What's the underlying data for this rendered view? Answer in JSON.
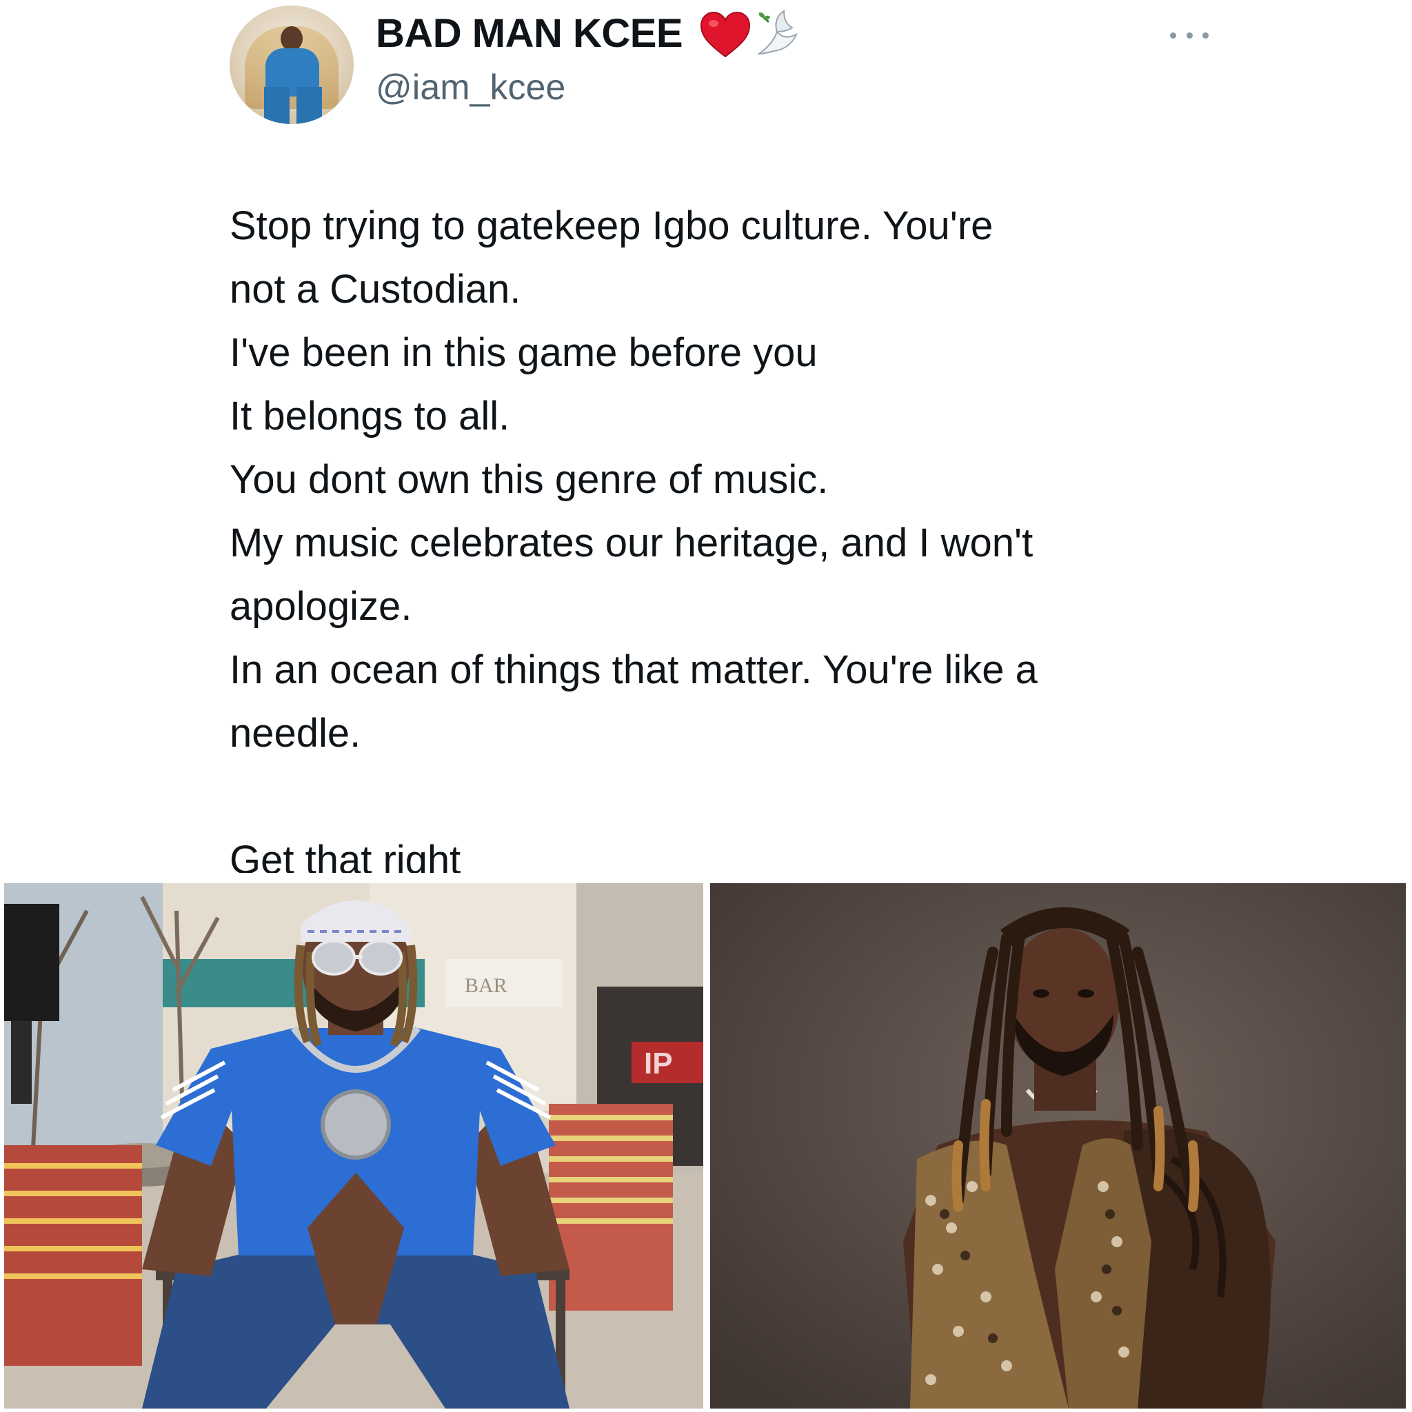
{
  "tweet": {
    "author": {
      "display_name": "BAD MAN KCEE",
      "handle": "@iam_kcee",
      "name_emojis": [
        "heart-icon",
        "dove-icon"
      ]
    },
    "more_menu_icon": "more-icon",
    "text_lines": [
      "Stop trying to gatekeep Igbo culture. You're",
      "not a Custodian.",
      "I've been in this game before you",
      "It belongs to all.",
      "You dont own this genre of music.",
      "My music celebrates our heritage, and I won't",
      "apologize.",
      "In an ocean of things that matter.  You're like a",
      "needle.",
      "",
      "Get that right"
    ],
    "photos": {
      "left": {
        "sign_text": "BAR",
        "store_text": "IP"
      },
      "right": {}
    }
  },
  "colors": {
    "text_primary": "#0f1419",
    "text_secondary": "#536471",
    "heart": "#e0152b",
    "background": "#ffffff"
  }
}
